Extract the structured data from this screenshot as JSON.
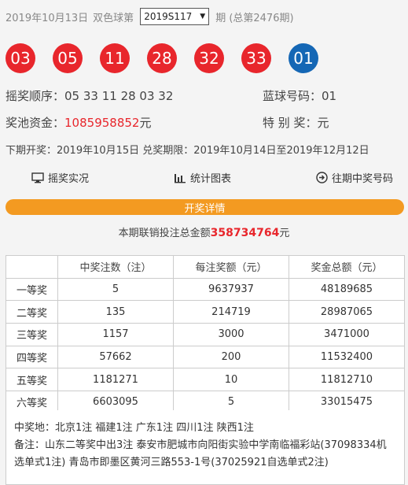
{
  "header": {
    "date": "2019年10月13日",
    "game": "双色球第",
    "issue_select": "2019S117",
    "period_suffix": "期 (总第2476期)"
  },
  "balls": [
    {
      "num": "03",
      "color": "red"
    },
    {
      "num": "05",
      "color": "red"
    },
    {
      "num": "11",
      "color": "red"
    },
    {
      "num": "28",
      "color": "red"
    },
    {
      "num": "32",
      "color": "red"
    },
    {
      "num": "33",
      "color": "red"
    },
    {
      "num": "01",
      "color": "blue"
    }
  ],
  "info": {
    "order_label": "摇奖顺序：",
    "order_value": "05 33 11 28 03 32",
    "blue_label": "蓝球号码：",
    "blue_value": "01",
    "pool_label": "奖池资金：",
    "pool_value": "1085958852",
    "pool_unit": "元",
    "special_label": "特 别 奖：",
    "special_value": "元",
    "next_draw": "下期开奖：2019年10月15日 兑奖期限：2019年10月14日至2019年12月12日"
  },
  "links": {
    "live": "摇奖实况",
    "stats": "统计图表",
    "history": "往期中奖号码"
  },
  "detail_bar": "开奖详情",
  "sales": {
    "prefix": "本期联销投注总金额",
    "amount": "358734764",
    "unit": "元"
  },
  "table": {
    "headers": [
      "",
      "中奖注数（注）",
      "每注奖额（元）",
      "奖金总额（元）"
    ],
    "rows": [
      [
        "一等奖",
        "5",
        "9637937",
        "48189685"
      ],
      [
        "二等奖",
        "135",
        "214719",
        "28987065"
      ],
      [
        "三等奖",
        "1157",
        "3000",
        "3471000"
      ],
      [
        "四等奖",
        "57662",
        "200",
        "11532400"
      ],
      [
        "五等奖",
        "1181271",
        "10",
        "11812710"
      ],
      [
        "六等奖",
        "6603095",
        "5",
        "33015475"
      ]
    ]
  },
  "footer": {
    "winners_place": "中奖地：北京1注 福建1注 广东1注 四川1注 陕西1注",
    "note": "备注：山东二等奖中出3注 泰安市肥城市向阳街实验中学南临福彩站(37098334机选单式1注) 青岛市即墨区黄河三路553-1号(37025921自选单式2注)"
  },
  "colors": {
    "red_ball": "#e8262c",
    "blue_ball": "#1567b5",
    "accent_bar": "#f39a21"
  }
}
